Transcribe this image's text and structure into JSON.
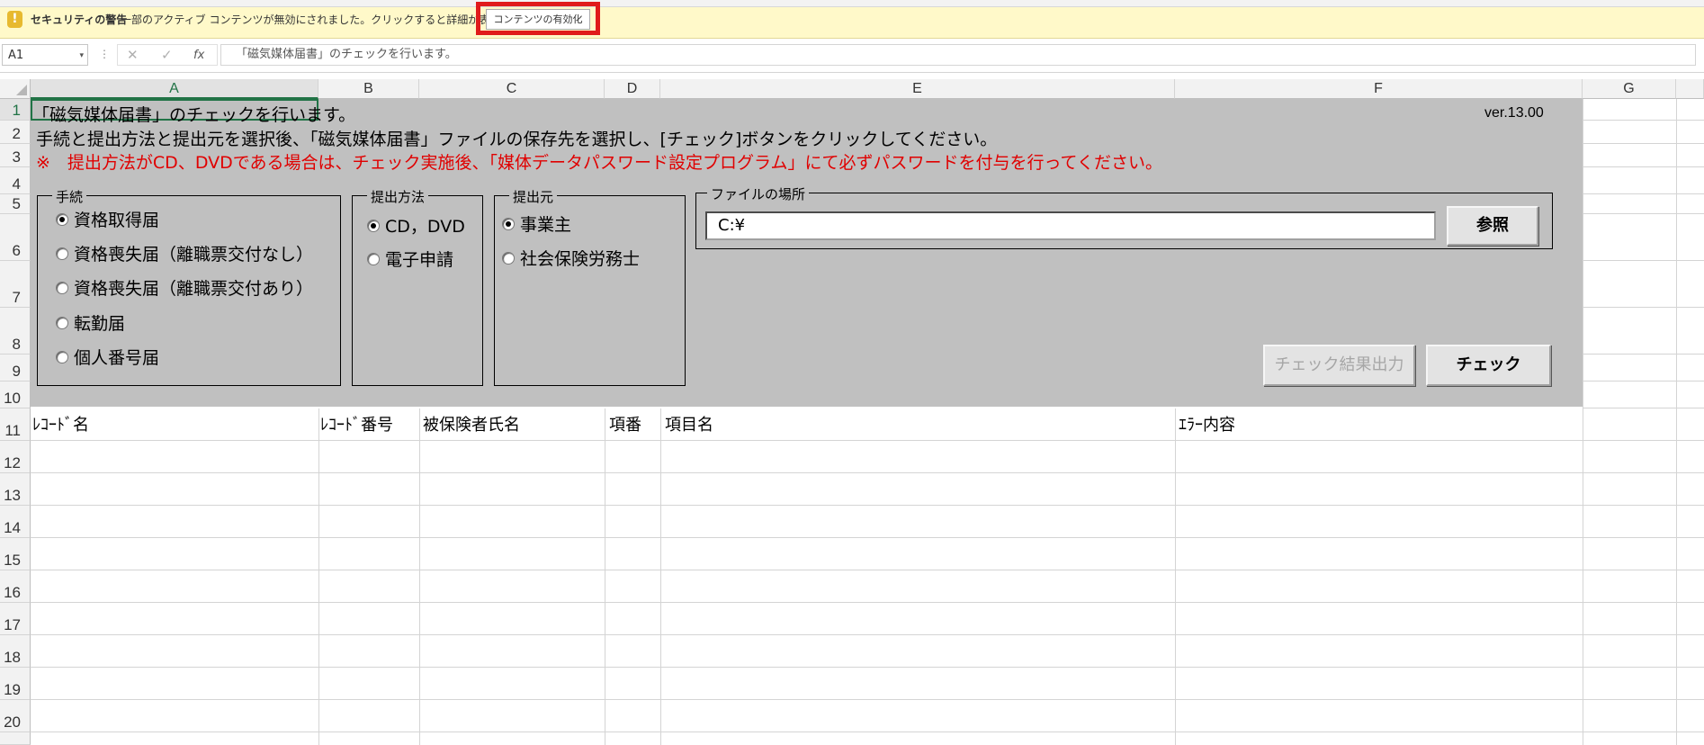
{
  "security_bar": {
    "icon": "warning-icon",
    "title": "セキュリティの警告",
    "message": "一部のアクティブ コンテンツが無効にされました。クリックすると詳細が表示されます。",
    "enable_button": "コンテンツの有効化"
  },
  "formula_bar": {
    "name_box": "A1",
    "name_box_dropdown": "▾",
    "dots": "⋮",
    "cancel_icon": "✕",
    "enter_icon": "✓",
    "fx_icon": "fx",
    "formula": "「磁気媒体届書」のチェックを行います。"
  },
  "columns": [
    "A",
    "B",
    "C",
    "D",
    "E",
    "F",
    "G"
  ],
  "rows": [
    "1",
    "2",
    "3",
    "4",
    "5",
    "6",
    "7",
    "8",
    "9",
    "10",
    "11",
    "12",
    "13",
    "14",
    "15",
    "16",
    "17",
    "18",
    "19",
    "20"
  ],
  "sheet": {
    "line1": "「磁気媒体届書」のチェックを行います。",
    "line2": "手続と提出方法と提出元を選択後、「磁気媒体届書」ファイルの保存先を選択し、[チェック]ボタンをクリックしてください。",
    "line3": "※　提出方法がCD、DVDである場合は、チェック実施後、「媒体データパスワード設定プログラム」にて必ずパスワードを付与を行ってください。",
    "version": "ver.13.00",
    "procedure": {
      "legend": "手続",
      "options": [
        {
          "label": "資格取得届",
          "selected": true
        },
        {
          "label": "資格喪失届（離職票交付なし）",
          "selected": false
        },
        {
          "label": "資格喪失届（離職票交付あり）",
          "selected": false
        },
        {
          "label": "転勤届",
          "selected": false
        },
        {
          "label": "個人番号届",
          "selected": false
        }
      ]
    },
    "method": {
      "legend": "提出方法",
      "options": [
        {
          "label": "CD，DVD",
          "selected": true
        },
        {
          "label": "電子申請",
          "selected": false
        }
      ]
    },
    "source": {
      "legend": "提出元",
      "options": [
        {
          "label": "事業主",
          "selected": true
        },
        {
          "label": "社会保険労務士",
          "selected": false
        }
      ]
    },
    "file": {
      "legend": "ファイルの場所",
      "path": "C:¥",
      "browse_button": "参照"
    },
    "output_button": "チェック結果出力",
    "check_button": "チェック",
    "table_headers": [
      "ﾚｺｰﾄﾞ名",
      "ﾚｺｰﾄﾞ番号",
      "被保険者氏名",
      "項番",
      "項目名",
      "ｴﾗｰ内容"
    ]
  }
}
